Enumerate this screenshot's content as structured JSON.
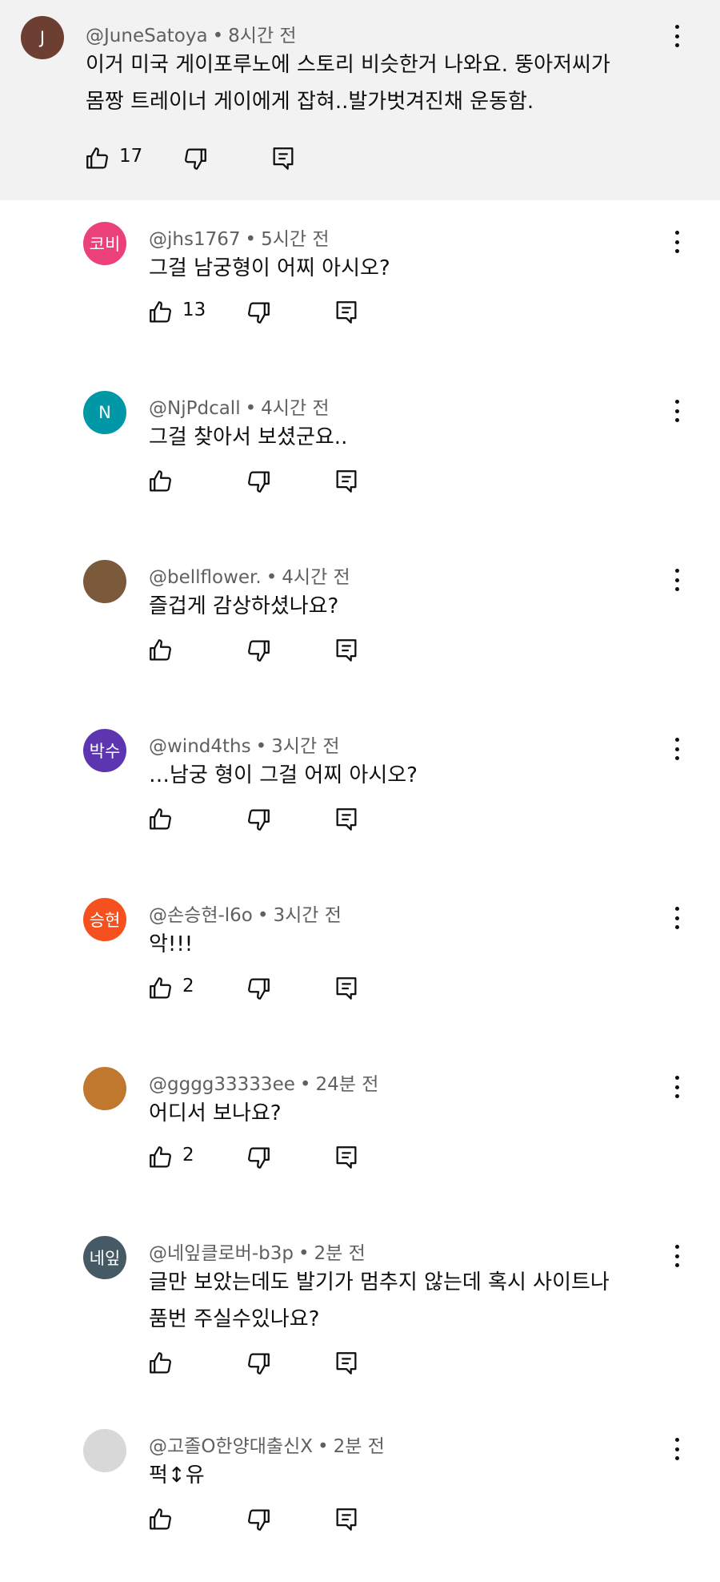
{
  "colors": {
    "top_bg": "#f2f2f2",
    "text": "#0f0f0f",
    "meta": "#606060"
  },
  "icons": {
    "like": "thumbs-up-outline",
    "dislike": "thumbs-down-outline",
    "reply": "comment-outline",
    "more": "three-dot-vertical"
  },
  "comments": [
    {
      "avatar": "J",
      "avatar_color": "#6d3f32",
      "handle": "@JuneSatoya",
      "time": "8시간 전",
      "lines": [
        "이거 미국 게이포루노에 스토리 비슷한거 나와요. 뚱아저씨가",
        "몸짱 트레이너 게이에게 잡혀..발가벗겨진채 운동함."
      ],
      "likes": "17"
    },
    {
      "avatar": "코비",
      "avatar_color": "#ec407a",
      "handle": "@jhs1767",
      "time": "5시간 전",
      "lines": [
        "그걸 남궁형이 어찌 아시오?"
      ],
      "likes": "13"
    },
    {
      "avatar": "N",
      "avatar_color": "#0097a7",
      "handle": "@NjPdcall",
      "time": "4시간 전",
      "lines": [
        "그걸 찾아서 보셨군요.."
      ],
      "likes": ""
    },
    {
      "avatar": "",
      "avatar_color": "#7a5a3a",
      "handle": "@bellflower.",
      "time": "4시간 전",
      "lines": [
        "즐겁게 감상하셨나요?"
      ],
      "likes": ""
    },
    {
      "avatar": "박수",
      "avatar_color": "#5e35b1",
      "handle": "@wind4ths",
      "time": "3시간 전",
      "lines": [
        "…남궁 형이 그걸 어찌 아시오?"
      ],
      "likes": ""
    },
    {
      "avatar": "승현",
      "avatar_color": "#f4511e",
      "handle": "@손승현-l6o",
      "time": "3시간 전",
      "lines": [
        "악!!!"
      ],
      "likes": "2"
    },
    {
      "avatar": "",
      "avatar_color": "#c0782e",
      "handle": "@gggg33333ee",
      "time": "24분 전",
      "lines": [
        "어디서 보나요?"
      ],
      "likes": "2"
    },
    {
      "avatar": "네잎",
      "avatar_color": "#455a64",
      "handle": "@네잎클로버-b3p",
      "time": "2분 전",
      "lines": [
        "글만 보았는데도 발기가 멈추지 않는데 혹시 사이트나",
        "품번 주실수있나요?"
      ],
      "likes": ""
    },
    {
      "avatar": "",
      "avatar_color": "#d8d8d8",
      "handle": "@고졸O한양대출신X",
      "time": "2분 전",
      "lines": [
        "퍽↕유"
      ],
      "likes": ""
    }
  ]
}
